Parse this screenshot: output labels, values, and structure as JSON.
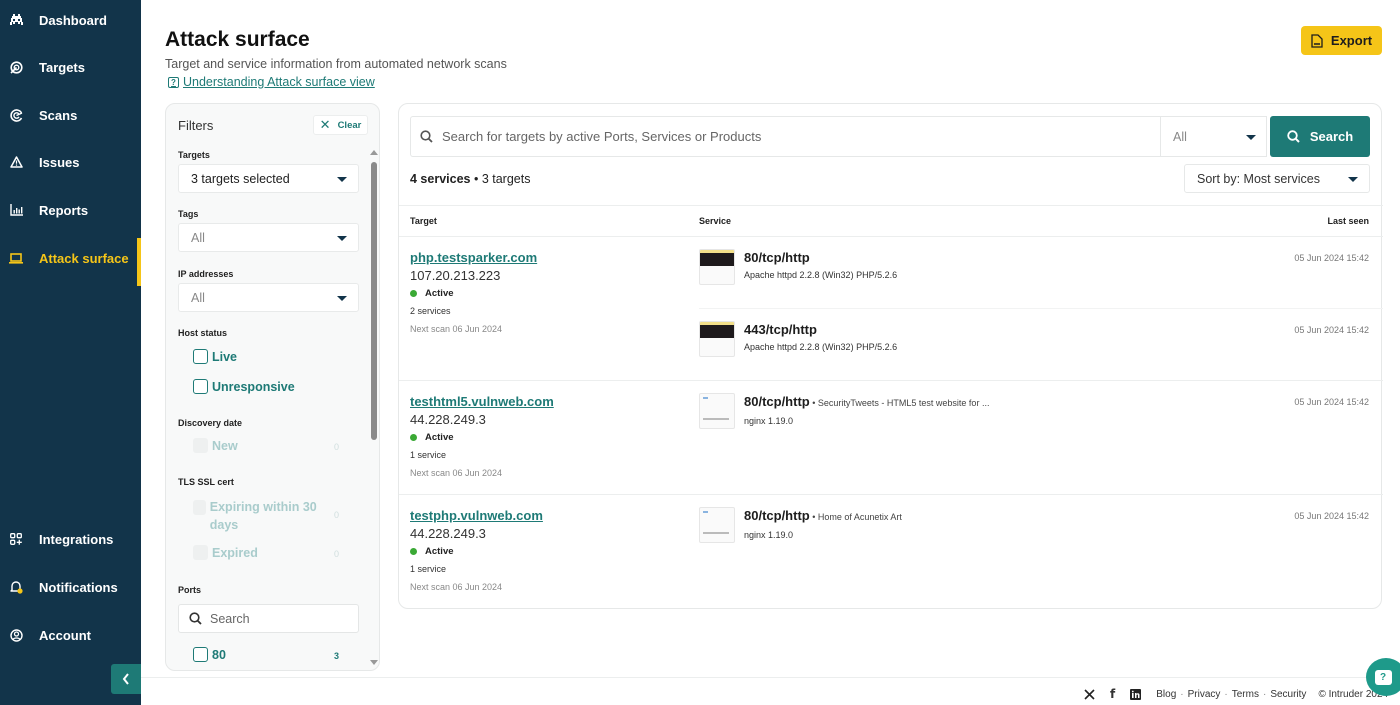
{
  "sidebar": {
    "items": [
      {
        "label": "Dashboard",
        "icon": "space-invader-icon"
      },
      {
        "label": "Targets",
        "icon": "target-icon"
      },
      {
        "label": "Scans",
        "icon": "radar-icon"
      },
      {
        "label": "Issues",
        "icon": "warning-icon"
      },
      {
        "label": "Reports",
        "icon": "bar-chart-icon"
      },
      {
        "label": "Attack surface",
        "icon": "laptop-icon",
        "active": true
      }
    ],
    "bottom_items": [
      {
        "label": "Integrations",
        "icon": "grid-plus-icon"
      },
      {
        "label": "Notifications",
        "icon": "bell-icon"
      },
      {
        "label": "Account",
        "icon": "user-circle-icon"
      }
    ],
    "collapse_icon": "chevron-left-icon"
  },
  "header": {
    "title": "Attack surface",
    "subtitle": "Target and service information from automated network scans",
    "help_link": "Understanding Attack surface view",
    "export_label": "Export"
  },
  "filters": {
    "title": "Filters",
    "clear_label": "Clear",
    "targets": {
      "label": "Targets",
      "value": "3 targets selected"
    },
    "tags": {
      "label": "Tags",
      "value": "All"
    },
    "ip_addresses": {
      "label": "IP addresses",
      "value": "All"
    },
    "host_status": {
      "label": "Host status",
      "options": [
        "Live",
        "Unresponsive"
      ]
    },
    "discovery_date": {
      "label": "Discovery date",
      "options": [
        {
          "label": "New",
          "count": "0"
        }
      ]
    },
    "tls_ssl_cert": {
      "label": "TLS SSL cert",
      "options": [
        {
          "label": "Expiring within 30 days",
          "count": "0"
        },
        {
          "label": "Expired",
          "count": "0"
        }
      ]
    },
    "ports": {
      "label": "Ports",
      "search_placeholder": "Search",
      "options": [
        {
          "label": "80",
          "count": "3"
        }
      ]
    }
  },
  "results": {
    "search_placeholder": "Search for targets by active Ports, Services or Products",
    "type_filter": "All",
    "search_label": "Search",
    "summary_services": "4 services",
    "summary_targets": "3 targets",
    "sort_label": "Sort by: Most services",
    "columns": {
      "target": "Target",
      "service": "Service",
      "last_seen": "Last seen"
    },
    "rows": [
      {
        "host": "php.testsparker.com",
        "ip": "107.20.213.223",
        "status": "Active",
        "service_count": "2 services",
        "next_scan": "Next scan 06 Jun 2024",
        "services": [
          {
            "port": "80/tcp/http",
            "extra": "",
            "product": "Apache httpd 2.2.8 (Win32) PHP/5.2.6",
            "last_seen": "05 Jun 2024 15:42"
          },
          {
            "port": "443/tcp/http",
            "extra": "",
            "product": "Apache httpd 2.2.8 (Win32) PHP/5.2.6",
            "last_seen": "05 Jun 2024 15:42"
          }
        ]
      },
      {
        "host": "testhtml5.vulnweb.com",
        "ip": "44.228.249.3",
        "status": "Active",
        "service_count": "1 service",
        "next_scan": "Next scan 06 Jun 2024",
        "services": [
          {
            "port": "80/tcp/http",
            "extra": " • SecurityTweets - HTML5 test website for ...",
            "product": "nginx 1.19.0",
            "last_seen": "05 Jun 2024 15:42"
          }
        ]
      },
      {
        "host": "testphp.vulnweb.com",
        "ip": "44.228.249.3",
        "status": "Active",
        "service_count": "1 service",
        "next_scan": "Next scan 06 Jun 2024",
        "services": [
          {
            "port": "80/tcp/http",
            "extra": " • Home of Acunetix Art",
            "product": "nginx 1.19.0",
            "last_seen": "05 Jun 2024 15:42"
          }
        ]
      }
    ]
  },
  "footer": {
    "social": [
      "x-icon",
      "facebook-icon",
      "linkedin-icon"
    ],
    "links": [
      "Blog",
      "Privacy",
      "Terms",
      "Security"
    ],
    "copyright": "© Intruder 2024"
  },
  "colors": {
    "sidebar_bg": "#12344a",
    "accent_yellow": "#f5c518",
    "teal": "#1e7a76",
    "status_active": "#3aa935"
  }
}
